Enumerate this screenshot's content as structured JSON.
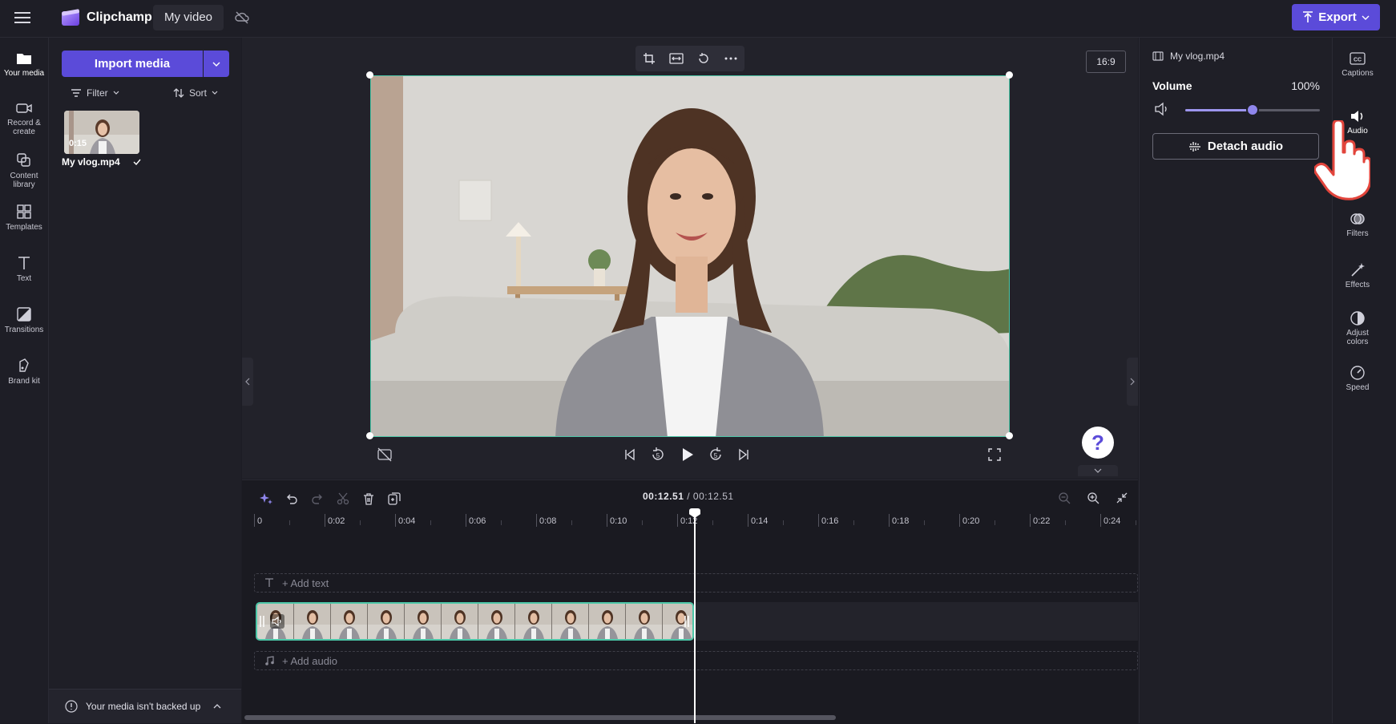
{
  "app": {
    "name": "Clipchamp",
    "project_title": "My video",
    "export_label": "Export"
  },
  "leftnav": [
    {
      "label1": "Your media",
      "label2": ""
    },
    {
      "label1": "Record &",
      "label2": "create"
    },
    {
      "label1": "Content",
      "label2": "library"
    },
    {
      "label1": "Templates",
      "label2": ""
    },
    {
      "label1": "Text",
      "label2": ""
    },
    {
      "label1": "Transitions",
      "label2": ""
    },
    {
      "label1": "Brand kit",
      "label2": ""
    }
  ],
  "media": {
    "import_label": "Import media",
    "filter_label": "Filter",
    "sort_label": "Sort",
    "item": {
      "name": "My vlog.mp4",
      "duration": "0:15"
    },
    "backup_notice": "Your media isn't backed up"
  },
  "preview": {
    "aspect_ratio": "16:9"
  },
  "properties": {
    "file_name": "My vlog.mp4",
    "volume_label": "Volume",
    "volume_value": "100%",
    "volume_level": 0.5,
    "detach_label": "Detach audio"
  },
  "rightnav": [
    {
      "label1": "Captions",
      "label2": ""
    },
    {
      "label1": "Audio",
      "label2": ""
    },
    {
      "label1": "Filters",
      "label2": ""
    },
    {
      "label1": "Effects",
      "label2": ""
    },
    {
      "label1": "Adjust",
      "label2": "colors"
    },
    {
      "label1": "Speed",
      "label2": ""
    }
  ],
  "timeline": {
    "current_time": "00:12.51",
    "separator": " / ",
    "total_time": "00:12.51",
    "ruler_labels": [
      "0",
      "0:02",
      "0:04",
      "0:06",
      "0:08",
      "0:10",
      "0:12",
      "0:14",
      "0:16",
      "0:18",
      "0:20",
      "0:22",
      "0:24"
    ],
    "add_text_label": "+ Add text",
    "add_audio_label": "+ Add audio"
  },
  "colors": {
    "accent": "#5b4bd9",
    "selection": "#4cc7a8",
    "background": "#1c1c24"
  }
}
